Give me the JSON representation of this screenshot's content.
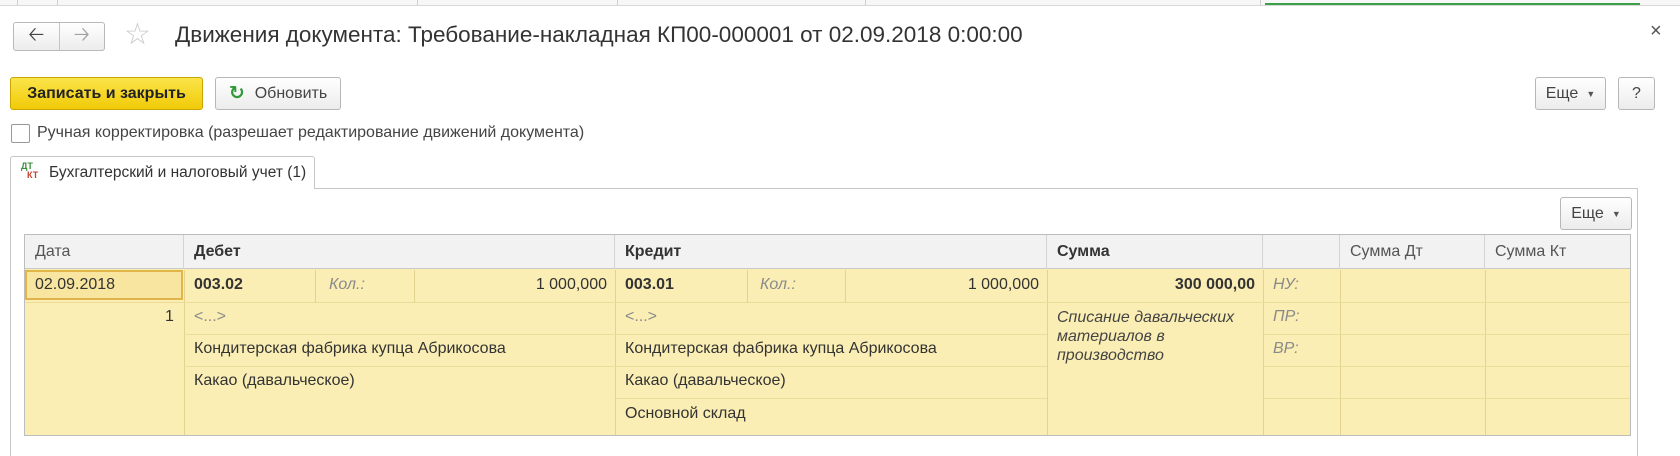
{
  "window": {
    "title": "Движения документа: Требование-накладная КП00-000001 от 02.09.2018 0:00:00",
    "close_glyph": "×"
  },
  "nav": {
    "back_icon": "arrow-left-icon",
    "forward_icon": "arrow-right-icon",
    "favorite_icon": "star-icon"
  },
  "toolbar": {
    "save_close_label": "Записать и закрыть",
    "refresh_label": "Обновить",
    "more_label": "Еще",
    "help_label": "?"
  },
  "manual_correction": {
    "label": "Ручная корректировка (разрешает редактирование движений документа)",
    "checked": false
  },
  "tabs": [
    {
      "label": "Бухгалтерский и налоговый учет (1)",
      "icon_top": "ДТ",
      "icon_bottom": "КТ"
    }
  ],
  "table_toolbar": {
    "more_label": "Еще"
  },
  "table": {
    "columns": {
      "date": "Дата",
      "debit": "Дебет",
      "credit": "Кредит",
      "sum": "Сумма",
      "blank": "",
      "sum_dt": "Сумма Дт",
      "sum_kt": "Сумма Кт"
    },
    "rows": [
      {
        "date": "02.09.2018",
        "number": "1",
        "debit": {
          "account": "003.02",
          "qty_label": "Кол.:",
          "qty": "1 000,000",
          "subconto1": "<...>",
          "subconto2": "Кондитерская фабрика купца Абрикосова",
          "subconto3": "Какао (давальческое)"
        },
        "credit": {
          "account": "003.01",
          "qty_label": "Кол.:",
          "qty": "1 000,000",
          "subconto1": "<...>",
          "subconto2": "Кондитерская фабрика купца Абрикосова",
          "subconto3": "Какао (давальческое)",
          "subconto4": "Основной склад"
        },
        "sum": "300 000,00",
        "content": "Списание давальческих материалов в производство",
        "tax_labels": [
          "НУ:",
          "ПР:",
          "ВР:"
        ]
      }
    ]
  },
  "colors": {
    "primary_button": "#f5d31d",
    "row_highlight": "#faeeb4",
    "refresh_icon": "#2f9a3a",
    "tab_strip_accent": "#3aa04a"
  }
}
